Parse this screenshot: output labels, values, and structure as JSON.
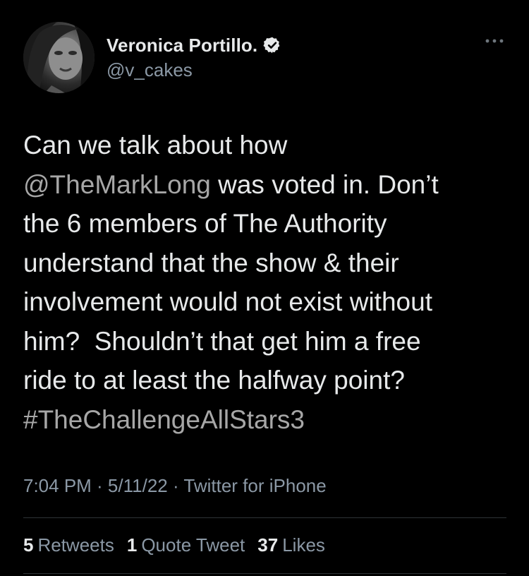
{
  "tweet": {
    "author": {
      "display_name": "Veronica Portillo.",
      "handle": "@v_cakes",
      "verified": true,
      "avatar_icon": "profile-photo"
    },
    "more_icon": "ellipsis-icon",
    "text": {
      "line1": "Can we talk about how",
      "mention": "@TheMarkLong",
      "line2_rest": " was voted in. Don’t",
      "line3": "the 6 members of The Authority",
      "line4": "understand that the show & their",
      "line5": "involvement would not exist without",
      "line6": "him?  Shouldn’t that get him a free",
      "line7": "ride to at least the halfway point?",
      "hashtag": "#TheChallengeAllStars3"
    },
    "meta": "7:04 PM · 5/11/22 · Twitter for iPhone",
    "stats": {
      "retweets_count": "5",
      "retweets_label": "Retweets",
      "quotes_count": "1",
      "quotes_label": "Quote Tweet",
      "likes_count": "37",
      "likes_label": "Likes"
    }
  },
  "colors": {
    "background": "#000000",
    "primary_text": "#e7e9ea",
    "secondary_text": "#8b98a5",
    "link_text": "#a7a7a7",
    "divider": "#2f3336"
  }
}
